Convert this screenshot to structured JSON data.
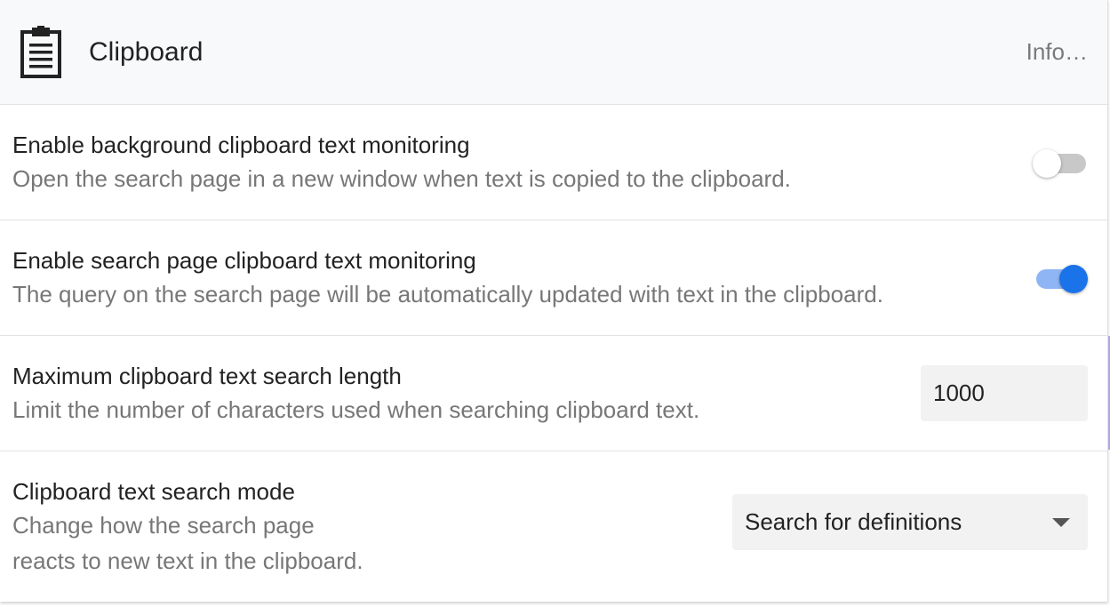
{
  "header": {
    "icon": "clipboard-icon",
    "title": "Clipboard",
    "info_label": "Info…"
  },
  "settings": [
    {
      "label": "Enable background clipboard text monitoring",
      "description": "Open the search page in a new window when text is copied to the clipboard.",
      "control": "toggle",
      "enabled": false
    },
    {
      "label": "Enable search page clipboard text monitoring",
      "description": "The query on the search page will be automatically updated with text in the clipboard.",
      "control": "toggle",
      "enabled": true
    },
    {
      "label": "Maximum clipboard text search length",
      "description": "Limit the number of characters used when searching clipboard text.",
      "control": "number",
      "value": "1000"
    },
    {
      "label": "Clipboard text search mode",
      "description": "Change how the search page reacts to new text in the clipboard.",
      "control": "select",
      "value": "Search for definitions"
    }
  ],
  "colors": {
    "accent": "#1a73e8",
    "accent_track": "#8fb5f5",
    "focus_bar": "#b3a7dc"
  }
}
